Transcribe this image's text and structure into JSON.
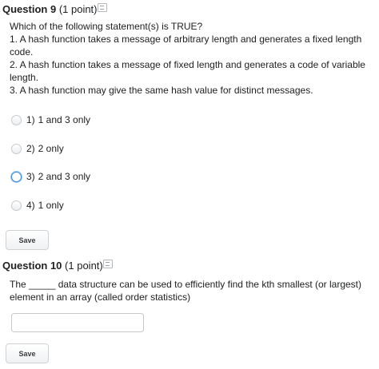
{
  "q9": {
    "title": "Question 9",
    "points": "(1 point)",
    "prompt_lines": [
      "Which of the following statement(s) is TRUE?",
      "1. A hash function takes a message of arbitrary length and generates a fixed length",
      "code.",
      "2. A hash function takes a message of fixed length and generates a code of variable",
      "length.",
      "3. A hash function may give the same hash value for distinct messages."
    ],
    "options": [
      {
        "num": "1)",
        "label": "1 and 3 only"
      },
      {
        "num": "2)",
        "label": "2 only"
      },
      {
        "num": "3)",
        "label": "2 and 3 only"
      },
      {
        "num": "4)",
        "label": "1 only"
      }
    ],
    "save_label": "Save"
  },
  "q10": {
    "title": "Question 10",
    "points": "(1 point)",
    "prompt_lines": [
      "The _____ data structure can be used to efficiently find the kth smallest (or largest)",
      "element in an array (called order statistics)"
    ],
    "answer_value": "",
    "save_label": "Save"
  }
}
